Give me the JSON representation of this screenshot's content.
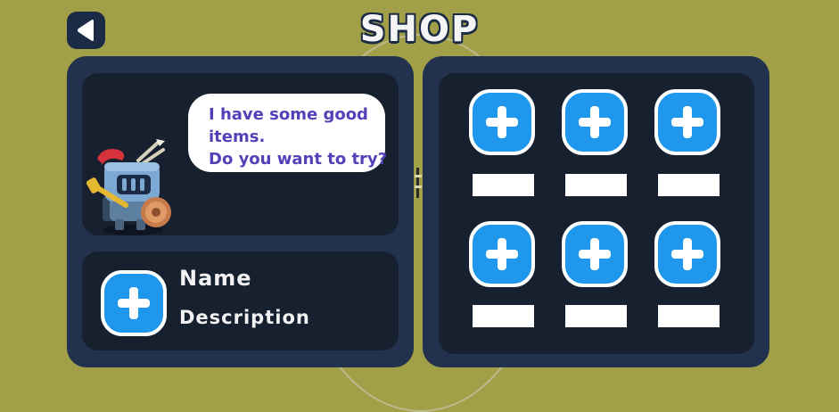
{
  "header": {
    "title": "SHOP",
    "back_icon": "play-back-icon"
  },
  "npc": {
    "dialogue": [
      "I have some good",
      "items.",
      "Do you want to try?"
    ],
    "character": "knight-character"
  },
  "detail": {
    "name": "Name",
    "description": "Description"
  },
  "shop": {
    "slots": [
      {
        "icon": "plus-icon",
        "price": ""
      },
      {
        "icon": "plus-icon",
        "price": ""
      },
      {
        "icon": "plus-icon",
        "price": ""
      },
      {
        "icon": "plus-icon",
        "price": ""
      },
      {
        "icon": "plus-icon",
        "price": ""
      },
      {
        "icon": "plus-icon",
        "price": ""
      }
    ]
  },
  "colors": {
    "background": "#a1a049",
    "panel": "#22314d",
    "panel_inner": "#16202f",
    "button_blue": "#1f97ec",
    "dialogue_text": "#5341b8"
  }
}
